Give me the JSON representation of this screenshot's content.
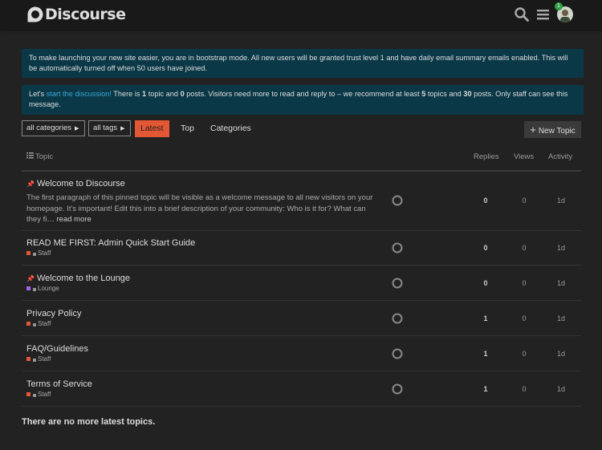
{
  "header": {
    "logo_text": "Discourse",
    "notification_count": "1"
  },
  "banners": {
    "bootstrap_text": "To make launching your new site easier, you are in bootstrap mode. All new users will be granted trust level 1 and have daily email summary emails enabled. This will be automatically turned off when 50 users have joined.",
    "education_prefix": "Let's ",
    "education_link": "start the discussion!",
    "education_text1": " There is ",
    "education_topics": "1",
    "education_text2": " topic and ",
    "education_posts": "0",
    "education_text3": " posts. Visitors need more to read and reply to – we recommend at least ",
    "education_rec_topics": "5",
    "education_text4": " topics and ",
    "education_rec_posts": "30",
    "education_text5": " posts. Only staff can see this message."
  },
  "nav": {
    "categories_dropdown": "all categories",
    "tags_dropdown": "all tags",
    "tabs": [
      "Latest",
      "Top",
      "Categories"
    ],
    "new_topic": "New Topic"
  },
  "table": {
    "columns": {
      "topic": "Topic",
      "replies": "Replies",
      "views": "Views",
      "activity": "Activity"
    },
    "topics": [
      {
        "title": "Welcome to Discourse",
        "pinned": true,
        "excerpt": "The first paragraph of this pinned topic will be visible as a welcome message to all new visitors on your homepage. It's important! Edit this into a brief description of your community: Who is it for? What can they fi…",
        "read_more": "read more",
        "category": "",
        "replies": "0",
        "views": "0",
        "activity": "1d"
      },
      {
        "title": "READ ME FIRST: Admin Quick Start Guide",
        "pinned": false,
        "category": "Staff",
        "category_color": "#e45735",
        "replies": "0",
        "views": "0",
        "activity": "1d"
      },
      {
        "title": "Welcome to the Lounge",
        "pinned": true,
        "category": "Lounge",
        "category_color": "#a461ef",
        "replies": "0",
        "views": "0",
        "activity": "1d"
      },
      {
        "title": "Privacy Policy",
        "pinned": false,
        "category": "Staff",
        "category_color": "#e45735",
        "replies": "1",
        "views": "0",
        "activity": "1d"
      },
      {
        "title": "FAQ/Guidelines",
        "pinned": false,
        "category": "Staff",
        "category_color": "#e45735",
        "replies": "1",
        "views": "0",
        "activity": "1d"
      },
      {
        "title": "Terms of Service",
        "pinned": false,
        "category": "Staff",
        "category_color": "#e45735",
        "replies": "1",
        "views": "0",
        "activity": "1d"
      }
    ]
  },
  "footer": {
    "text": "There are no more latest topics."
  },
  "colors": {
    "accent": "#e45735",
    "banner": "#0b3846",
    "link": "#3aa6d6",
    "background": "#222222"
  },
  "icons": [
    "discourse-logo-icon",
    "search-icon",
    "hamburger-icon",
    "plus-icon",
    "pin-icon",
    "list-icon",
    "lock-icon"
  ]
}
